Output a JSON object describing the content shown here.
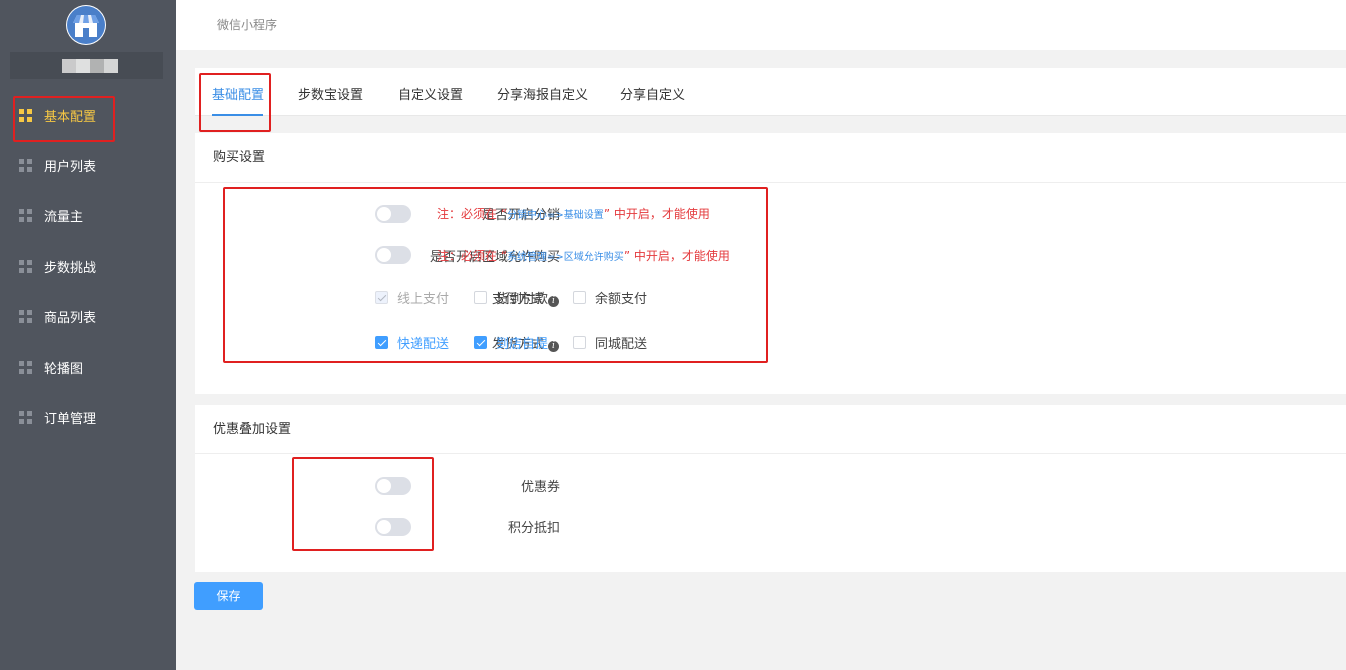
{
  "sidebar": {
    "items": [
      {
        "label": "基本配置"
      },
      {
        "label": "用户列表"
      },
      {
        "label": "流量主"
      },
      {
        "label": "步数挑战"
      },
      {
        "label": "商品列表"
      },
      {
        "label": "轮播图"
      },
      {
        "label": "订单管理"
      }
    ]
  },
  "topbar": {
    "breadcrumb": "微信小程序"
  },
  "tabs": [
    {
      "label": "基础配置"
    },
    {
      "label": "步数宝设置"
    },
    {
      "label": "自定义设置"
    },
    {
      "label": "分享海报自定义"
    },
    {
      "label": "分享自定义"
    }
  ],
  "purchase": {
    "title": "购买设置",
    "distribution_label": "是否开启分销",
    "distribution_note_prefix": "注：必须在 “",
    "distribution_note_path": "分销中心=>基础设置",
    "distribution_note_suffix": "” 中开启，才能使用",
    "region_label": "是否开启区域允许购买",
    "region_note_prefix": "注：必须在 “",
    "region_note_path": "系统管理=>区域允许购买",
    "region_note_suffix": "” 中开启，才能使用",
    "payment_label": "支付方式",
    "payment_options": [
      {
        "label": "线上支付"
      },
      {
        "label": "货到付款"
      },
      {
        "label": "余额支付"
      }
    ],
    "delivery_label": "发货方式",
    "delivery_options": [
      {
        "label": "快递配送"
      },
      {
        "label": "到店自提"
      },
      {
        "label": "同城配送"
      }
    ]
  },
  "discount": {
    "title": "优惠叠加设置",
    "coupon_label": "优惠券",
    "points_label": "积分抵扣"
  },
  "save_label": "保存",
  "colors": {
    "sidebar_bg": "#50555e",
    "active_nav": "#f7c844",
    "primary": "#409eff",
    "note_red": "#e4393c",
    "highlight_red": "#e02020"
  }
}
